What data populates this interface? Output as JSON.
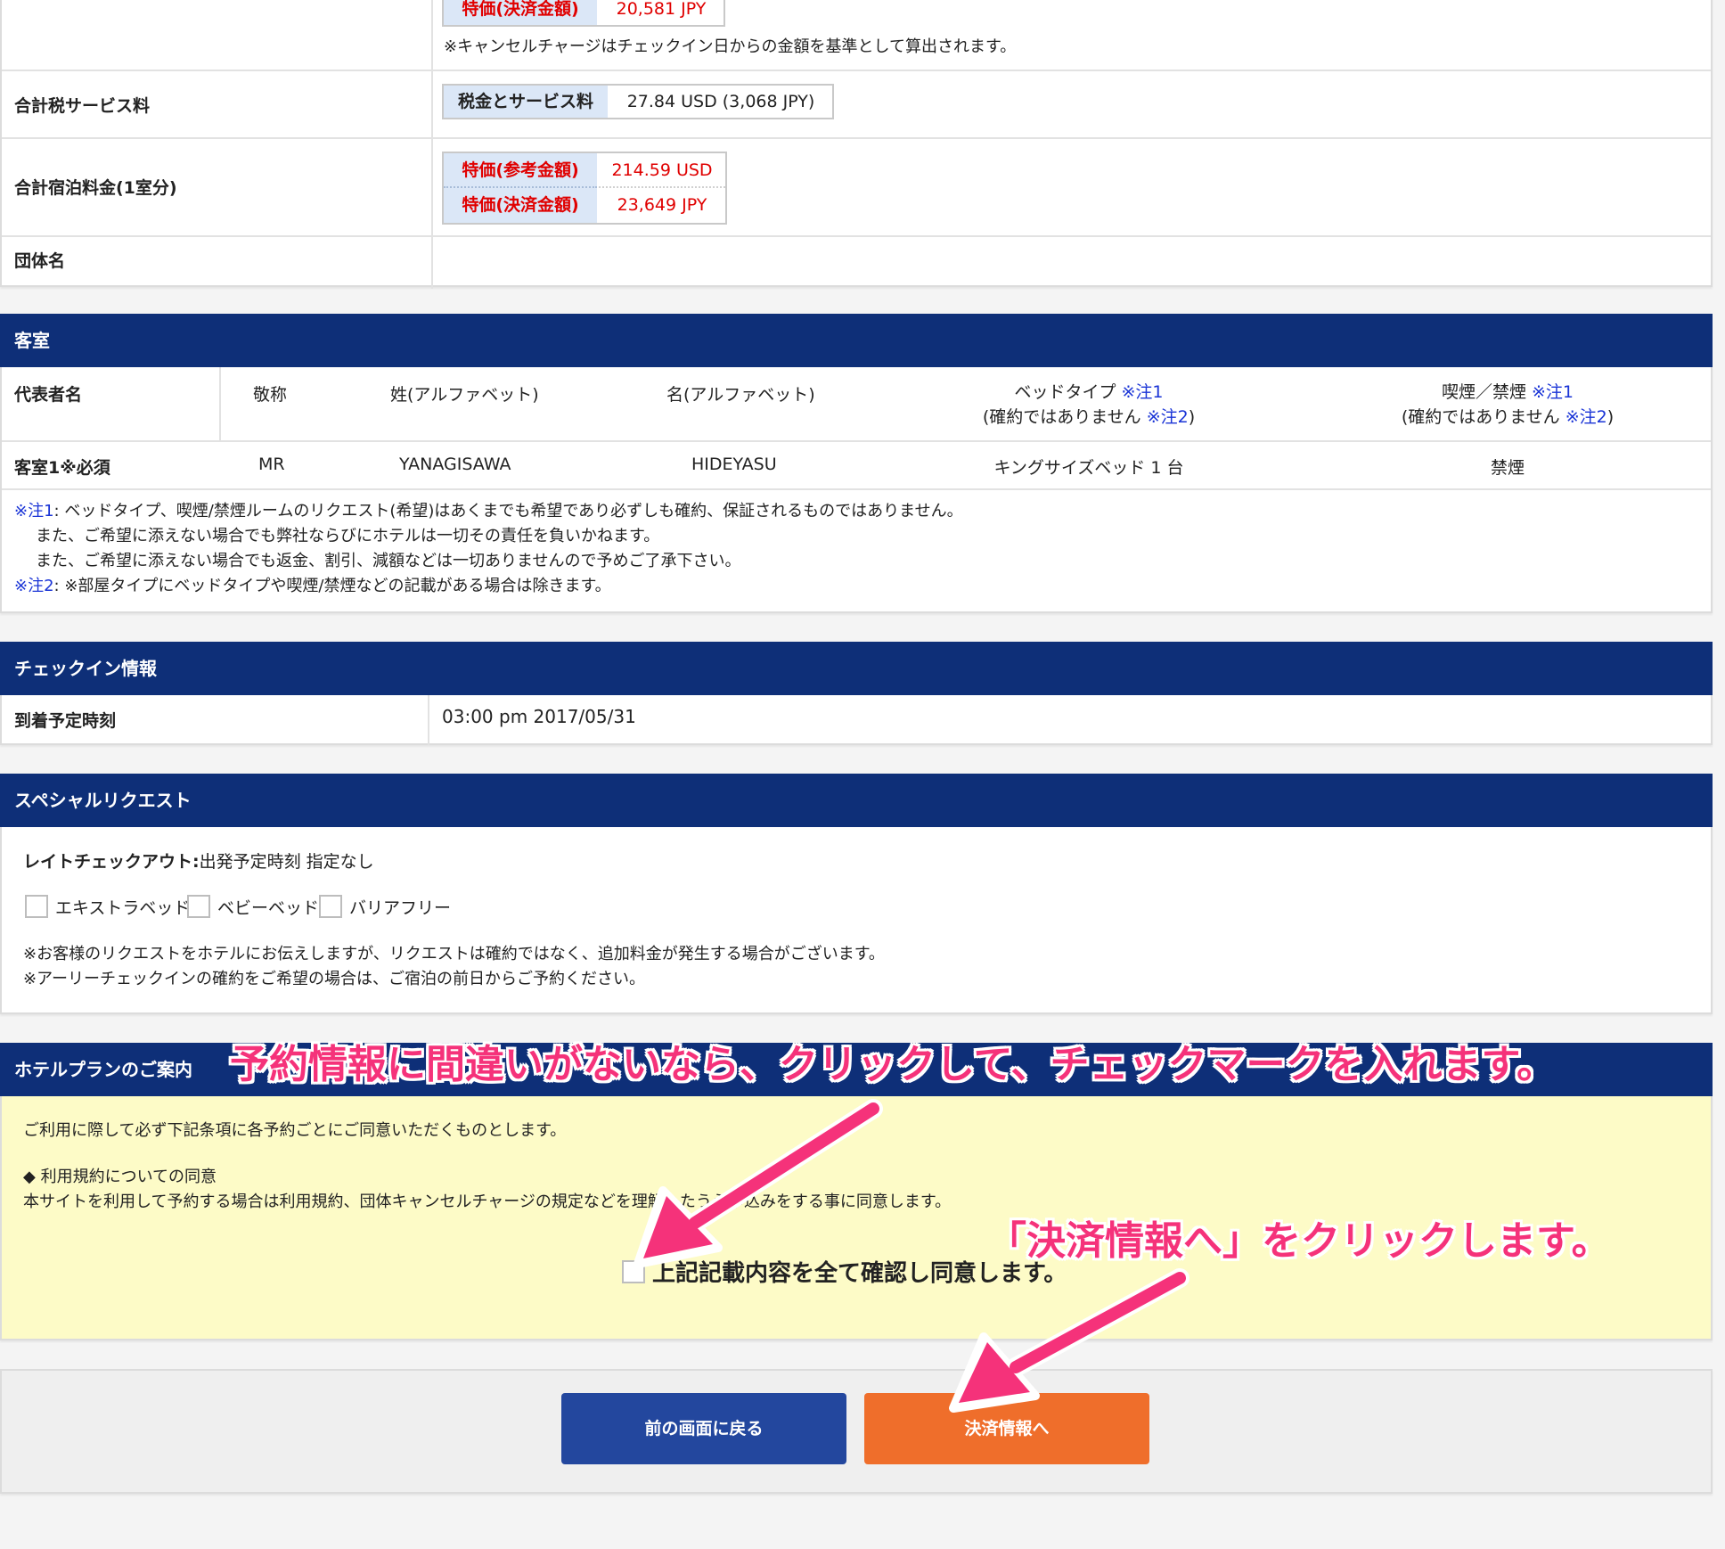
{
  "pricing": {
    "top_label": "特価(決済金額)",
    "top_value": "20,581 JPY",
    "cancel_note": "※キャンセルチャージはチェックイン日からの金額を基準として算出されます。",
    "tax_row_label": "合計税サービス料",
    "tax_box_label": "税金とサービス料",
    "tax_box_value": "27.84 USD (3,068 JPY)",
    "total_row_label": "合計宿泊料金(1室分)",
    "ref_label": "特価(参考金額)",
    "ref_value": "214.59 USD",
    "pay_label": "特価(決済金額)",
    "pay_value": "23,649 JPY",
    "group_label": "団体名"
  },
  "room": {
    "header": "客室",
    "col_rep": "代表者名",
    "col_title": "敬称",
    "col_last": "姓(アルファベット)",
    "col_first": "名(アルファベット)",
    "col_bed": "ベッドタイプ",
    "col_bed_note": "※注1",
    "col_bed_sub_a": "(確約ではありません",
    "col_bed_sub_note": "※注2",
    "col_bed_sub_b": ")",
    "col_smoke": "喫煙／禁煙",
    "col_smoke_note": "※注1",
    "col_smoke_sub_a": "(確約ではありません",
    "col_smoke_sub_note": "※注2",
    "col_smoke_sub_b": ")",
    "row_label": "客室1※必須",
    "row_title": "MR",
    "row_last": "YANAGISAWA",
    "row_first": "HIDEYASU",
    "row_bed": "キングサイズベッド 1 台",
    "row_smoke": "禁煙",
    "note1_tag": "※注1",
    "note1_l1": ": ベッドタイプ、喫煙/禁煙ルームのリクエスト(希望)はあくまでも希望であり必ずしも確約、保証されるものではありません。",
    "note1_l2": "また、ご希望に添えない場合でも弊社ならびにホテルは一切その責任を負いかねます。",
    "note1_l3": "また、ご希望に添えない場合でも返金、割引、減額などは一切ありませんので予めご了承下さい。",
    "note2_tag": "※注2",
    "note2_text": ": ※部屋タイプにベッドタイプや喫煙/禁煙などの記載がある場合は除きます。"
  },
  "checkin": {
    "header": "チェックイン情報",
    "label": "到着予定時刻",
    "value": "03:00 pm 2017/05/31"
  },
  "special": {
    "header": "スペシャルリクエスト",
    "late_label": "レイトチェックアウト:",
    "late_text": "出発予定時刻 指定なし",
    "opt1": "エキストラベッド",
    "opt2": "ベビーベッド",
    "opt3": "バリアフリー",
    "note1": "※お客様のリクエストをホテルにお伝えしますが、リクエストは確約ではなく、追加料金が発生する場合がございます。",
    "note2": "※アーリーチェックインの確約をご希望の場合は、ご宿泊の前日からご予約ください。"
  },
  "plan": {
    "header": "ホテルプランのご案内",
    "intro": "ご利用に際して必ず下記条項に各予約ごとにご同意いただくものとします。",
    "terms_title": "◆ 利用規約についての同意",
    "terms_text": "本サイトを利用して予約する場合は利用規約、団体キャンセルチャージの規定などを理解したうえ申込みをする事に同意します。",
    "agree_label": "上記記載内容を全て確認し同意します。"
  },
  "buttons": {
    "back": "前の画面に戻る",
    "next": "決済情報へ"
  },
  "annotations": {
    "top": "予約情報に間違いがないなら、クリックして、チェックマークを入れます。",
    "bottom": "「決済情報へ」をクリックします。"
  },
  "colors": {
    "header_bg": "#0e2f78",
    "price_red": "#e00000",
    "note_blue": "#1a34d6",
    "plan_bg": "#fdfbc7",
    "back_btn": "#23479e",
    "next_btn": "#ef6e2b",
    "annotation": "#f5327a"
  }
}
